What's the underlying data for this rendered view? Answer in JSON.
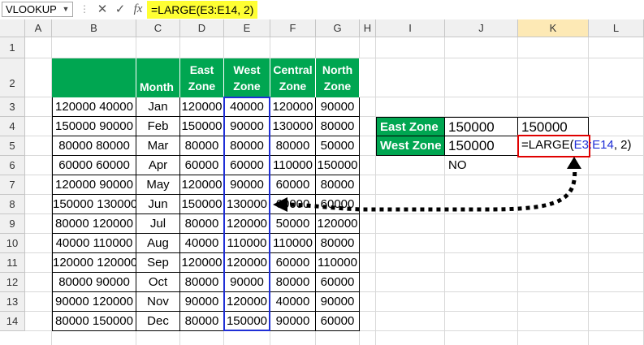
{
  "formula_bar": {
    "name_box": "VLOOKUP",
    "name_box_arrow": "▼",
    "dots": "⋮",
    "cancel": "✕",
    "enter": "✓",
    "fx": "fx",
    "formula": "=LARGE(E3:E14, 2)"
  },
  "columns": [
    "A",
    "B",
    "C",
    "D",
    "E",
    "F",
    "G",
    "H",
    "I",
    "J",
    "K",
    "L"
  ],
  "rows": [
    "1",
    "2",
    "3",
    "4",
    "5",
    "6",
    "7",
    "8",
    "9",
    "10",
    "11",
    "12",
    "13",
    "14"
  ],
  "table": {
    "headers": {
      "month": "Month",
      "east_1": "East",
      "east_2": "Zone",
      "west_1": "West",
      "west_2": "Zone",
      "central_1": "Central",
      "central_2": "Zone",
      "north_1": "North",
      "north_2": "Zone"
    },
    "rows": [
      {
        "b": "120000 40000",
        "month": "Jan",
        "east": "120000",
        "west": "40000",
        "central": "120000",
        "north": "90000"
      },
      {
        "b": "150000 90000",
        "month": "Feb",
        "east": "150000",
        "west": "90000",
        "central": "130000",
        "north": "80000"
      },
      {
        "b": "80000 80000",
        "month": "Mar",
        "east": "80000",
        "west": "80000",
        "central": "80000",
        "north": "50000"
      },
      {
        "b": "60000 60000",
        "month": "Apr",
        "east": "60000",
        "west": "60000",
        "central": "110000",
        "north": "150000"
      },
      {
        "b": "120000 90000",
        "month": "May",
        "east": "120000",
        "west": "90000",
        "central": "60000",
        "north": "80000"
      },
      {
        "b": "150000 130000",
        "month": "Jun",
        "east": "150000",
        "west": "130000",
        "central": "60000",
        "north": "60000"
      },
      {
        "b": "80000 120000",
        "month": "Jul",
        "east": "80000",
        "west": "120000",
        "central": "50000",
        "north": "120000"
      },
      {
        "b": "40000 110000",
        "month": "Aug",
        "east": "40000",
        "west": "110000",
        "central": "110000",
        "north": "80000"
      },
      {
        "b": "120000 120000",
        "month": "Sep",
        "east": "120000",
        "west": "120000",
        "central": "60000",
        "north": "110000"
      },
      {
        "b": "80000 90000",
        "month": "Oct",
        "east": "80000",
        "west": "90000",
        "central": "80000",
        "north": "60000"
      },
      {
        "b": "90000 120000",
        "month": "Nov",
        "east": "90000",
        "west": "120000",
        "central": "40000",
        "north": "90000"
      },
      {
        "b": "80000 150000",
        "month": "Dec",
        "east": "80000",
        "west": "150000",
        "central": "90000",
        "north": "60000"
      }
    ]
  },
  "summary": {
    "east_label": "East Zone",
    "east_value": "150000",
    "east_k": "150000",
    "west_label": "West Zone",
    "west_value": "150000",
    "result": "NO",
    "k5_formula_prefix": "=LARGE(",
    "k5_formula_range": "E3:E14",
    "k5_formula_suffix": ", 2)"
  },
  "colors": {
    "header_green": "#00a651",
    "selection_blue": "#1f2fd6",
    "highlight_red": "#e00000",
    "formula_yellow": "#ffff33"
  }
}
